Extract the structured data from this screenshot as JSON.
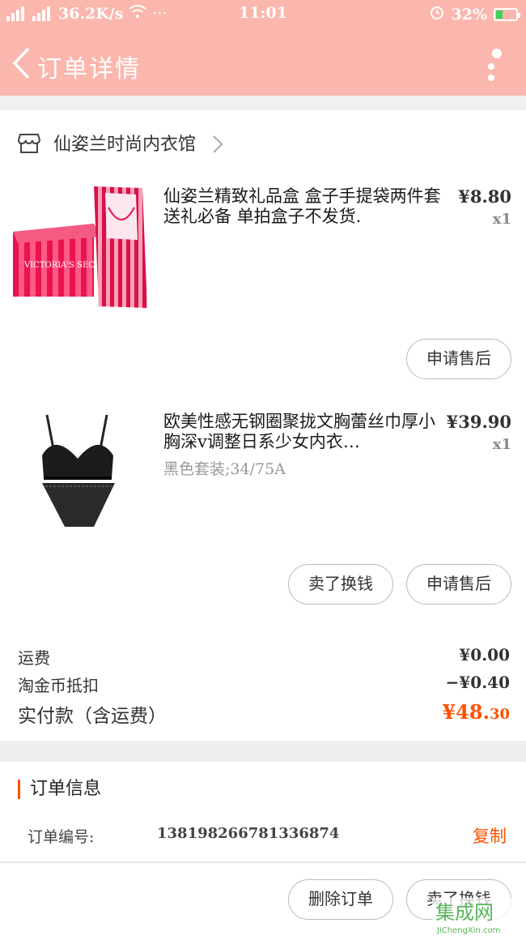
{
  "status": {
    "net": "36.2K/s",
    "time": "11:01",
    "battery": "32%",
    "battery_fraction": 0.32
  },
  "header": {
    "title": "订单详情"
  },
  "shop": {
    "name": "仙姿兰时尚内衣馆"
  },
  "items": [
    {
      "title": "仙姿兰精致礼品盒 盒子手提袋两件套送礼必备 单拍盒子不发货.",
      "price": "¥8.80",
      "qty": "x1",
      "sku": "",
      "image_text": "VICTORIA'S SECRET"
    },
    {
      "title": "欧美性感无钢圈聚拢文胸蕾丝巾厚小胸深v调整日系少女内衣…",
      "price": "¥39.90",
      "qty": "x1",
      "sku": "黑色套装;34/75A"
    }
  ],
  "buttons": {
    "after_sale": "申请售后",
    "resell": "卖了换钱",
    "delete_order": "删除订单"
  },
  "summary": {
    "shipping_label": "运费",
    "shipping_value": "¥0.00",
    "coin_label": "淘金币抵扣",
    "coin_value": "−¥0.40",
    "total_label": "实付款（含运费）",
    "total_main": "¥48.",
    "total_cents": "30"
  },
  "order_info": {
    "heading": "订单信息",
    "number_label": "订单编号:",
    "number": "138198266781336874",
    "copy": "复制"
  },
  "watermark": {
    "cn": "集成网",
    "en": "JiChengXin.com"
  }
}
